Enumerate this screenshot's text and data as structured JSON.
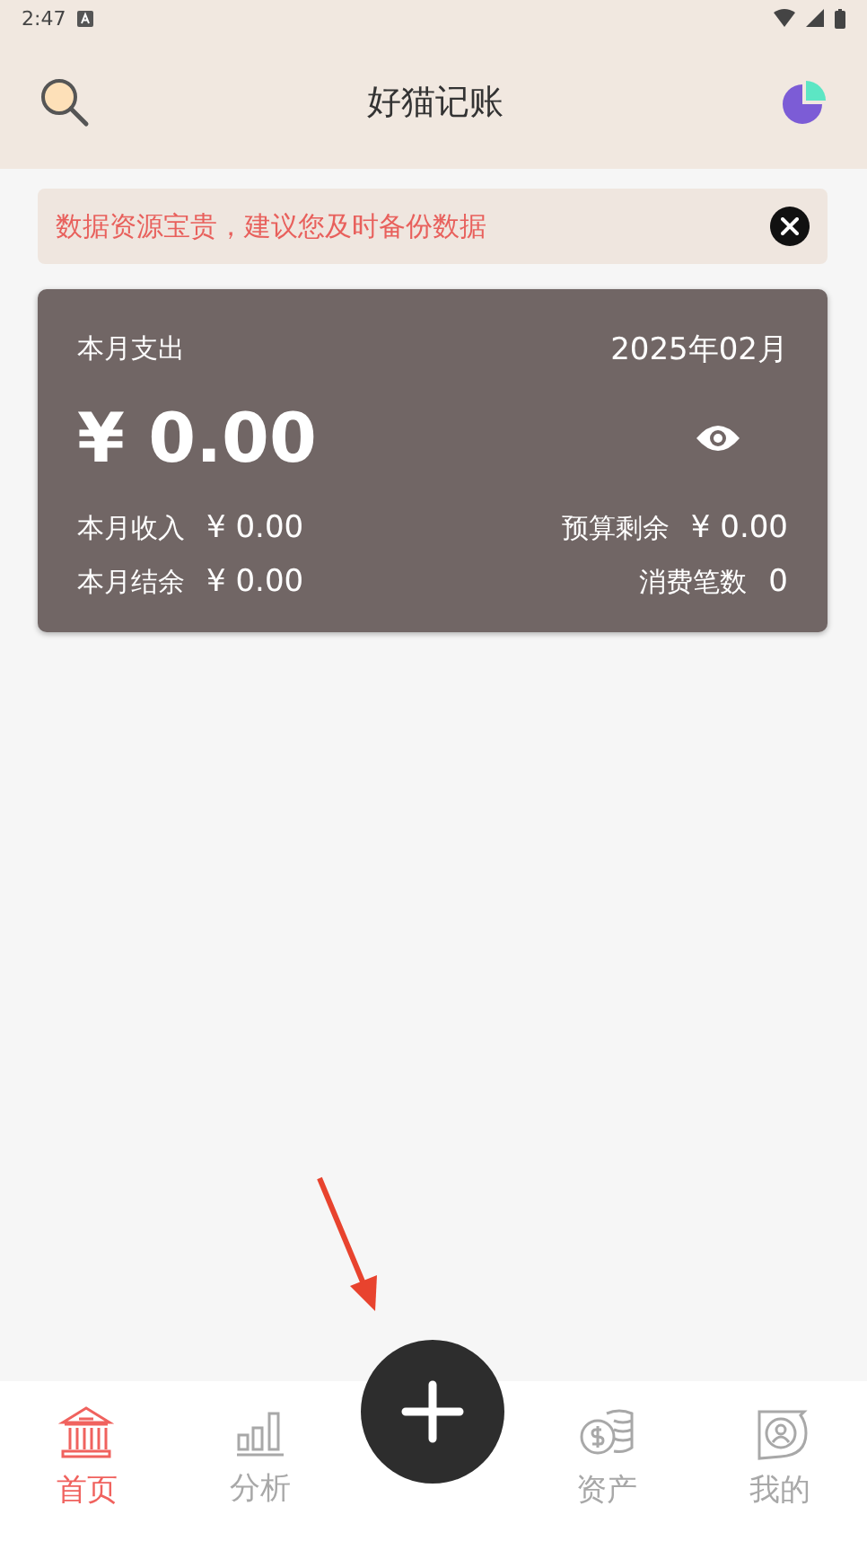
{
  "status_bar": {
    "time": "2:47"
  },
  "header": {
    "title": "好猫记账"
  },
  "notice": {
    "text": "数据资源宝贵，建议您及时备份数据"
  },
  "summary_card": {
    "label": "本月支出",
    "month": "2025年02月",
    "amount": "¥ 0.00",
    "stats": [
      {
        "label": "本月收入",
        "value": "¥ 0.00"
      },
      {
        "label": "预算剩余",
        "value": "¥ 0.00"
      },
      {
        "label": "本月结余",
        "value": "¥ 0.00"
      },
      {
        "label": "消费笔数",
        "value": "0"
      }
    ]
  },
  "tab_bar": [
    {
      "kind": "home",
      "label": "首页",
      "selected": true
    },
    {
      "kind": "chart",
      "label": "分析",
      "selected": false
    },
    {
      "kind": "add"
    },
    {
      "kind": "coins",
      "label": "资产",
      "selected": false
    },
    {
      "kind": "profile",
      "label": "我的",
      "selected": false
    }
  ]
}
